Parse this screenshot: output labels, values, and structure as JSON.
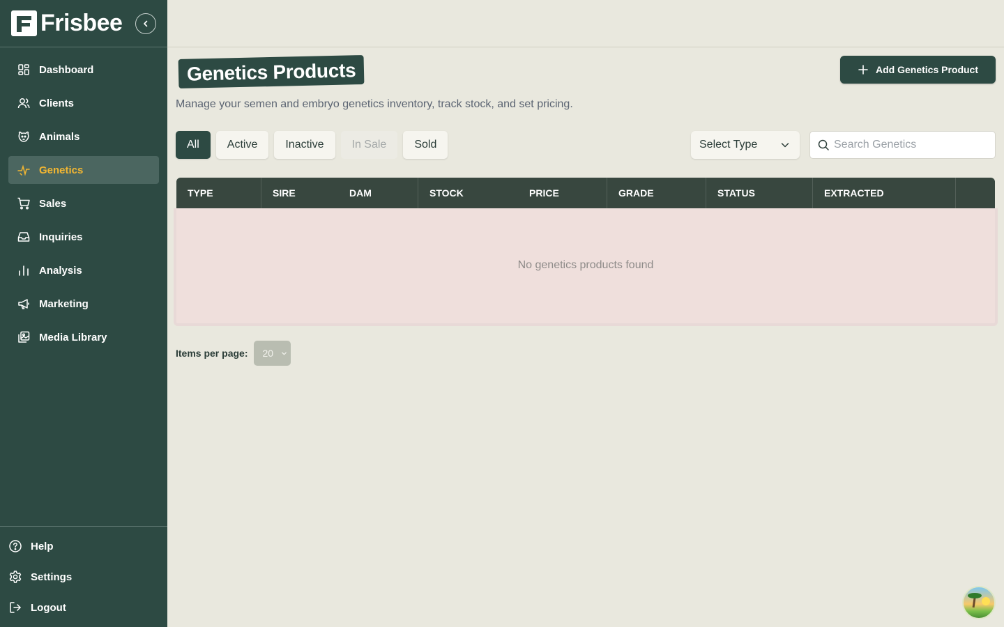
{
  "brand": {
    "name": "Frisbee"
  },
  "sidebar": {
    "items": [
      {
        "label": "Dashboard",
        "icon": "dashboard-icon"
      },
      {
        "label": "Clients",
        "icon": "users-icon"
      },
      {
        "label": "Animals",
        "icon": "animal-icon"
      },
      {
        "label": "Genetics",
        "icon": "genetics-icon",
        "active": true
      },
      {
        "label": "Sales",
        "icon": "cart-icon"
      },
      {
        "label": "Inquiries",
        "icon": "inbox-icon"
      },
      {
        "label": "Analysis",
        "icon": "bar-chart-icon"
      },
      {
        "label": "Marketing",
        "icon": "megaphone-icon"
      },
      {
        "label": "Media Library",
        "icon": "image-library-icon"
      }
    ],
    "bottom": [
      {
        "label": "Help",
        "icon": "help-icon"
      },
      {
        "label": "Settings",
        "icon": "gear-icon"
      },
      {
        "label": "Logout",
        "icon": "logout-icon"
      }
    ]
  },
  "page": {
    "title": "Genetics Products",
    "subtitle": "Manage your semen and embryo genetics inventory, track stock, and set pricing.",
    "add_button": "Add Genetics Product"
  },
  "filters": {
    "tabs": [
      {
        "label": "All",
        "state": "active"
      },
      {
        "label": "Active",
        "state": "normal"
      },
      {
        "label": "Inactive",
        "state": "normal"
      },
      {
        "label": "In Sale",
        "state": "disabled"
      },
      {
        "label": "Sold",
        "state": "normal"
      }
    ],
    "type_select": "Select Type",
    "search_placeholder": "Search Genetics"
  },
  "table": {
    "columns": [
      "TYPE",
      "SIRE",
      "DAM",
      "STOCK",
      "PRICE",
      "GRADE",
      "STATUS",
      "EXTRACTED",
      ""
    ],
    "empty_message": "No genetics products found"
  },
  "pagination": {
    "label": "Items per page:",
    "value": "20"
  },
  "colors": {
    "sidebar": "#2d4a43",
    "accent": "#f2b632",
    "background": "#e9e8de",
    "table_header": "#38473f"
  }
}
